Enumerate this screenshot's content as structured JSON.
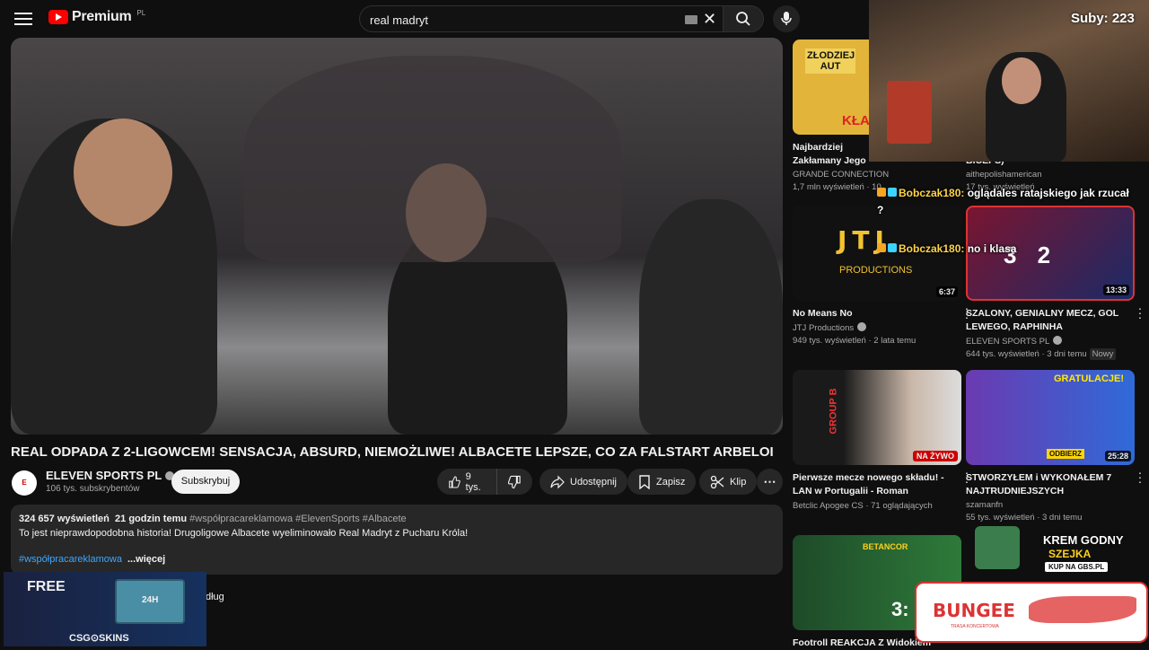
{
  "header": {
    "logo_text": "Premium",
    "logo_country": "PL",
    "search_value": "real madryt"
  },
  "video": {
    "title": "REAL ODPADA Z 2-LIGOWCEM! SENSACJA, ABSURD, NIEMOŻLIWE! ALBACETE LEPSZE, CO ZA FALSTART ARBELOI",
    "channel": "ELEVEN SPORTS PL",
    "channel_avatar_text": "ELEVEN SPORTS",
    "subscribers": "106 tys. subskrybentów",
    "subscribe_label": "Subskrybuj",
    "likes": "9 tys.",
    "share_label": "Udostępnij",
    "save_label": "Zapisz",
    "clip_label": "Klip"
  },
  "description": {
    "views": "324 657 wyświetleń",
    "age": "21 godzin temu",
    "tags": "#współpracareklamowa #ElevenSports #Albacete",
    "body": "To jest nieprawdopodobna historia! Drugoligowe Albacete wyeliminowało Real Madryt z Pucharu Króla!",
    "hashtag": "#współpracareklamowa",
    "more": "...więcej"
  },
  "partial_text": "dług",
  "overlay": {
    "subs": "Suby: 223",
    "chat": [
      {
        "user": "Bobczak180:",
        "message": "oglądales ratajskiego jak rzucał ?"
      },
      {
        "user": "Bobczak180:",
        "message": "no i klasa"
      }
    ]
  },
  "ads": {
    "csgo_free": "FREE",
    "csgo_brand": "CSG⊙SKINS",
    "chest_label": "24H",
    "gbs_line1": "KREM GODNY",
    "gbs_line2": "SZEJKA",
    "gbs_cta": "KUP NA GBS.PL",
    "bungee": "BUNGEE",
    "bungee_sub": "TRASA KONCERTOWA"
  },
  "sidebar": {
    "cards": [
      {
        "title": "Najbardziej Zakłamany Jego Biznesy",
        "channel": "GRANDE CONNECTION",
        "meta": "1,7 mln wyświetleń · 10",
        "thumb_text": "ZŁODZIEJ AUT",
        "thumb_badge": "KŁA"
      },
      {
        "title": "DEBIUT KSW (ZERWANY BICEPS)",
        "channel": "aithepolishamerican",
        "meta": "17 tys. wyświetleń",
        "thumb_text": ""
      },
      {
        "title": "No Means No",
        "channel": "JTJ Productions",
        "meta": "949 tys. wyświetleń · 2 lata temu",
        "duration": "6:37",
        "thumb_text": "JTJ",
        "thumb_sub": "PRODUCTIONS"
      },
      {
        "title": "SZALONY, GENIALNY MECZ, GOL LEWEGO, RAPHINHA BOHATEREM...",
        "channel": "ELEVEN SPORTS PL",
        "meta": "644 tys. wyświetleń · 3 dni temu",
        "new": "Nowy",
        "duration": "13:33",
        "thumb_text": "3  2"
      },
      {
        "title": "Pierwsze mecze nowego składu! - LAN w Portugalii - Roman Imperium...",
        "channel": "Betclic Apogee CS",
        "meta": "71 oglądających",
        "live": "NA ŻYWO",
        "thumb_text": "GROUP B"
      },
      {
        "title": "STWORZYŁEM i WYKONAŁEM 7 NAJTRUDNIEJSZYCH OSIĄGNIĘĆ...",
        "channel": "szamanfn",
        "meta": "55 tys. wyświetleń · 3 dni temu",
        "duration": "25:28",
        "thumb_text": "GRATULACJE!",
        "thumb_sub": "ODBIERZ"
      },
      {
        "title": "Footroll REAKCJA Z Widokiem",
        "channel": "",
        "meta": "",
        "thumb_text": "BETANCOR",
        "thumb_score": "3:"
      }
    ]
  }
}
